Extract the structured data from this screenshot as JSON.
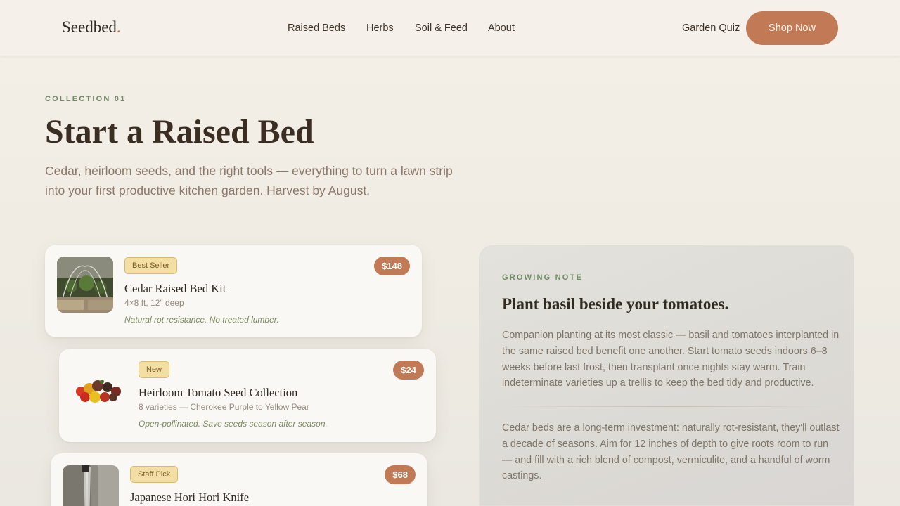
{
  "header": {
    "logo": "Seedbed",
    "logo_dot": ".",
    "nav": [
      "Raised Beds",
      "Herbs",
      "Soil & Feed",
      "About"
    ],
    "quiz_link": "Garden Quiz",
    "cta": "Shop Now"
  },
  "hero": {
    "eyebrow": "COLLECTION 01",
    "title": "Start a Raised Bed",
    "subtitle": "Cedar, heirloom seeds, and the right tools — everything to turn a lawn strip into your first productive kitchen garden. Harvest by August."
  },
  "products": [
    {
      "badge": "Best Seller",
      "price": "$148",
      "name": "Cedar Raised Bed Kit",
      "spec": "4×8 ft, 12″ deep",
      "note": "Natural rot resistance. No treated lumber.",
      "image_icon": "raised-bed-photo"
    },
    {
      "badge": "New",
      "price": "$24",
      "name": "Heirloom Tomato Seed Collection",
      "spec": "8 varieties — Cherokee Purple to Yellow Pear",
      "note": "Open-pollinated. Save seeds season after season.",
      "image_icon": "tomatoes-photo"
    },
    {
      "badge": "Staff Pick",
      "price": "$68",
      "name": "Japanese Hori Hori Knife",
      "spec": "",
      "note": "",
      "image_icon": "knife-photo"
    }
  ],
  "growing_note": {
    "eyebrow": "GROWING NOTE",
    "title": "Plant basil beside your tomatoes.",
    "paragraph1": "Companion planting at its most classic — basil and tomatoes interplanted in the same raised bed benefit one another. Start tomato seeds indoors 6–8 weeks before last frost, then transplant once nights stay warm. Train indeterminate varieties up a trellis to keep the bed tidy and productive.",
    "paragraph2": "Cedar beds are a long-term investment: naturally rot-resistant, they'll outlast a decade of seasons. Aim for 12 inches of depth to give roots room to run — and fill with a rich blend of compost, vermiculite, and a handful of worm castings."
  },
  "colors": {
    "accent": "#c27a56",
    "sage": "#6f8a62",
    "badge_bg": "#f3dea3"
  }
}
